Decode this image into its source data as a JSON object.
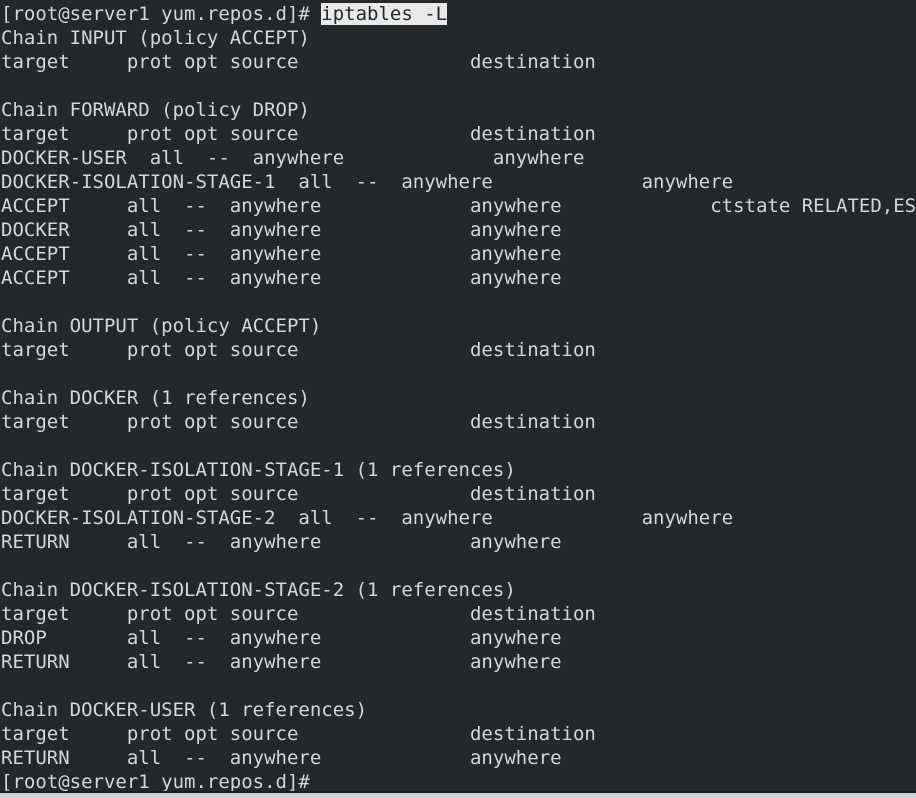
{
  "terminal": {
    "background_color": "#24282b",
    "foreground_color": "#d3d7da",
    "selection_background_color": "#e9e9e9",
    "selection_foreground_color": "#24282b",
    "prompt": "[root@server1 yum.repos.d]#",
    "typed_command": "iptables -L",
    "lines": [
      {
        "id": "l00",
        "segments": [
          {
            "text": "[root@server1 yum.repos.d]#",
            "selected": false
          }
        ]
      },
      {
        "id": "l01",
        "segments": [
          {
            "text": "[root@server1 yum.repos.d]# ",
            "selected": false
          },
          {
            "text": "iptables -L",
            "selected": true
          }
        ]
      },
      {
        "id": "l02",
        "segments": [
          {
            "text": "Chain INPUT (policy ACCEPT)",
            "selected": false
          }
        ]
      },
      {
        "id": "l03",
        "segments": [
          {
            "text": "target     prot opt source               destination",
            "selected": false
          }
        ]
      },
      {
        "id": "l04",
        "segments": [
          {
            "text": "",
            "selected": false
          }
        ]
      },
      {
        "id": "l05",
        "segments": [
          {
            "text": "Chain FORWARD (policy DROP)",
            "selected": false
          }
        ]
      },
      {
        "id": "l06",
        "segments": [
          {
            "text": "target     prot opt source               destination",
            "selected": false
          }
        ]
      },
      {
        "id": "l07",
        "segments": [
          {
            "text": "DOCKER-USER  all  --  anywhere             anywhere",
            "selected": false
          }
        ]
      },
      {
        "id": "l08",
        "segments": [
          {
            "text": "DOCKER-ISOLATION-STAGE-1  all  --  anywhere             anywhere",
            "selected": false
          }
        ]
      },
      {
        "id": "l09",
        "segments": [
          {
            "text": "ACCEPT     all  --  anywhere             anywhere             ctstate RELATED,ESTABLISHED",
            "selected": false
          }
        ]
      },
      {
        "id": "l10",
        "segments": [
          {
            "text": "DOCKER     all  --  anywhere             anywhere",
            "selected": false
          }
        ]
      },
      {
        "id": "l11",
        "segments": [
          {
            "text": "ACCEPT     all  --  anywhere             anywhere",
            "selected": false
          }
        ]
      },
      {
        "id": "l12",
        "segments": [
          {
            "text": "ACCEPT     all  --  anywhere             anywhere",
            "selected": false
          }
        ]
      },
      {
        "id": "l13",
        "segments": [
          {
            "text": "",
            "selected": false
          }
        ]
      },
      {
        "id": "l14",
        "segments": [
          {
            "text": "Chain OUTPUT (policy ACCEPT)",
            "selected": false
          }
        ]
      },
      {
        "id": "l15",
        "segments": [
          {
            "text": "target     prot opt source               destination",
            "selected": false
          }
        ]
      },
      {
        "id": "l16",
        "segments": [
          {
            "text": "",
            "selected": false
          }
        ]
      },
      {
        "id": "l17",
        "segments": [
          {
            "text": "Chain DOCKER (1 references)",
            "selected": false
          }
        ]
      },
      {
        "id": "l18",
        "segments": [
          {
            "text": "target     prot opt source               destination",
            "selected": false
          }
        ]
      },
      {
        "id": "l19",
        "segments": [
          {
            "text": "",
            "selected": false
          }
        ]
      },
      {
        "id": "l20",
        "segments": [
          {
            "text": "Chain DOCKER-ISOLATION-STAGE-1 (1 references)",
            "selected": false
          }
        ]
      },
      {
        "id": "l21",
        "segments": [
          {
            "text": "target     prot opt source               destination",
            "selected": false
          }
        ]
      },
      {
        "id": "l22",
        "segments": [
          {
            "text": "DOCKER-ISOLATION-STAGE-2  all  --  anywhere             anywhere",
            "selected": false
          }
        ]
      },
      {
        "id": "l23",
        "segments": [
          {
            "text": "RETURN     all  --  anywhere             anywhere",
            "selected": false
          }
        ]
      },
      {
        "id": "l24",
        "segments": [
          {
            "text": "",
            "selected": false
          }
        ]
      },
      {
        "id": "l25",
        "segments": [
          {
            "text": "Chain DOCKER-ISOLATION-STAGE-2 (1 references)",
            "selected": false
          }
        ]
      },
      {
        "id": "l26",
        "segments": [
          {
            "text": "target     prot opt source               destination",
            "selected": false
          }
        ]
      },
      {
        "id": "l27",
        "segments": [
          {
            "text": "DROP       all  --  anywhere             anywhere",
            "selected": false
          }
        ]
      },
      {
        "id": "l28",
        "segments": [
          {
            "text": "RETURN     all  --  anywhere             anywhere",
            "selected": false
          }
        ]
      },
      {
        "id": "l29",
        "segments": [
          {
            "text": "",
            "selected": false
          }
        ]
      },
      {
        "id": "l30",
        "segments": [
          {
            "text": "Chain DOCKER-USER (1 references)",
            "selected": false
          }
        ]
      },
      {
        "id": "l31",
        "segments": [
          {
            "text": "target     prot opt source               destination",
            "selected": false
          }
        ]
      },
      {
        "id": "l32",
        "segments": [
          {
            "text": "RETURN     all  --  anywhere             anywhere",
            "selected": false
          }
        ]
      },
      {
        "id": "l33",
        "segments": [
          {
            "text": "[root@server1 yum.repos.d]#",
            "selected": false
          }
        ]
      }
    ]
  }
}
